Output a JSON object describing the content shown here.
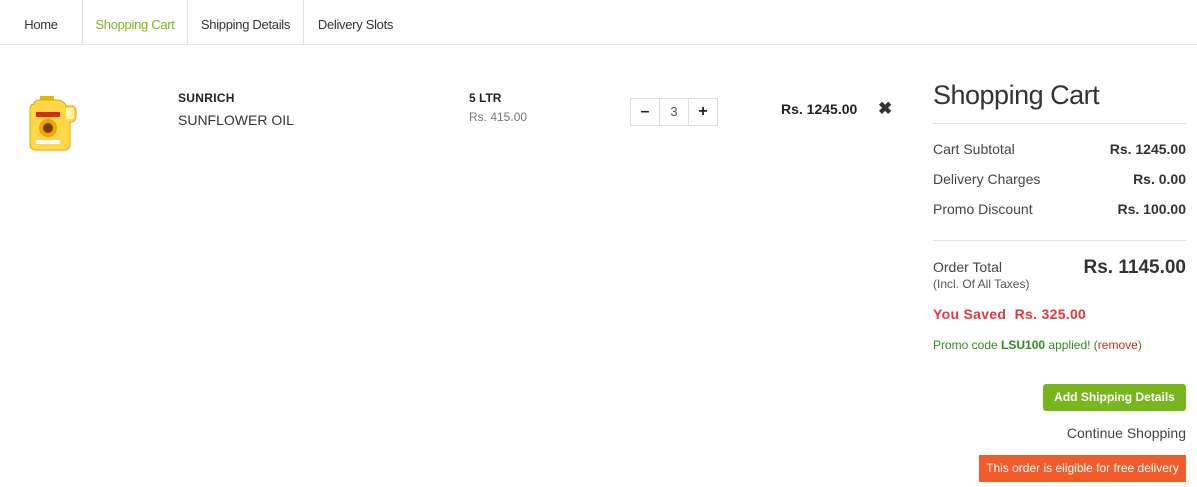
{
  "tabs": [
    {
      "label": "Home"
    },
    {
      "label": "Shopping Cart"
    },
    {
      "label": "Shipping Details"
    },
    {
      "label": "Delivery Slots"
    }
  ],
  "colors": {
    "accent": "#7ab41d",
    "button_green": "#79b51c",
    "saved_red": "#e0393e",
    "banner_orange": "#f15c2a"
  },
  "cart_item": {
    "brand": "SUNRICH",
    "name": "SUNFLOWER OIL",
    "size": "5 LTR",
    "unit_price": "Rs. 415.00",
    "quantity": "3",
    "decrement": "–",
    "increment": "+",
    "line_total": "Rs. 1245.00",
    "remove_icon": "✖",
    "image_icon": "oil-bottle-icon"
  },
  "summary": {
    "title": "Shopping Cart",
    "subtotal_label": "Cart Subtotal",
    "subtotal_value": "Rs. 1245.00",
    "delivery_label": "Delivery Charges",
    "delivery_value": "Rs. 0.00",
    "promo_label": "Promo Discount",
    "promo_value": "Rs. 100.00",
    "order_total_label": "Order Total",
    "order_total_note": "(Incl. Of All Taxes)",
    "order_total_value": "Rs. 1145.00",
    "saved_label": "You Saved",
    "saved_value": "Rs. 325.00",
    "promo_prefix": "Promo code",
    "promo_code": "LSU100",
    "promo_suffix": "applied! (",
    "promo_remove": "remove",
    "promo_close": ")"
  },
  "actions": {
    "add_shipping": "Add Shipping Details",
    "continue_shopping": "Continue Shopping",
    "free_delivery": "This order is eligible for free delivery"
  }
}
